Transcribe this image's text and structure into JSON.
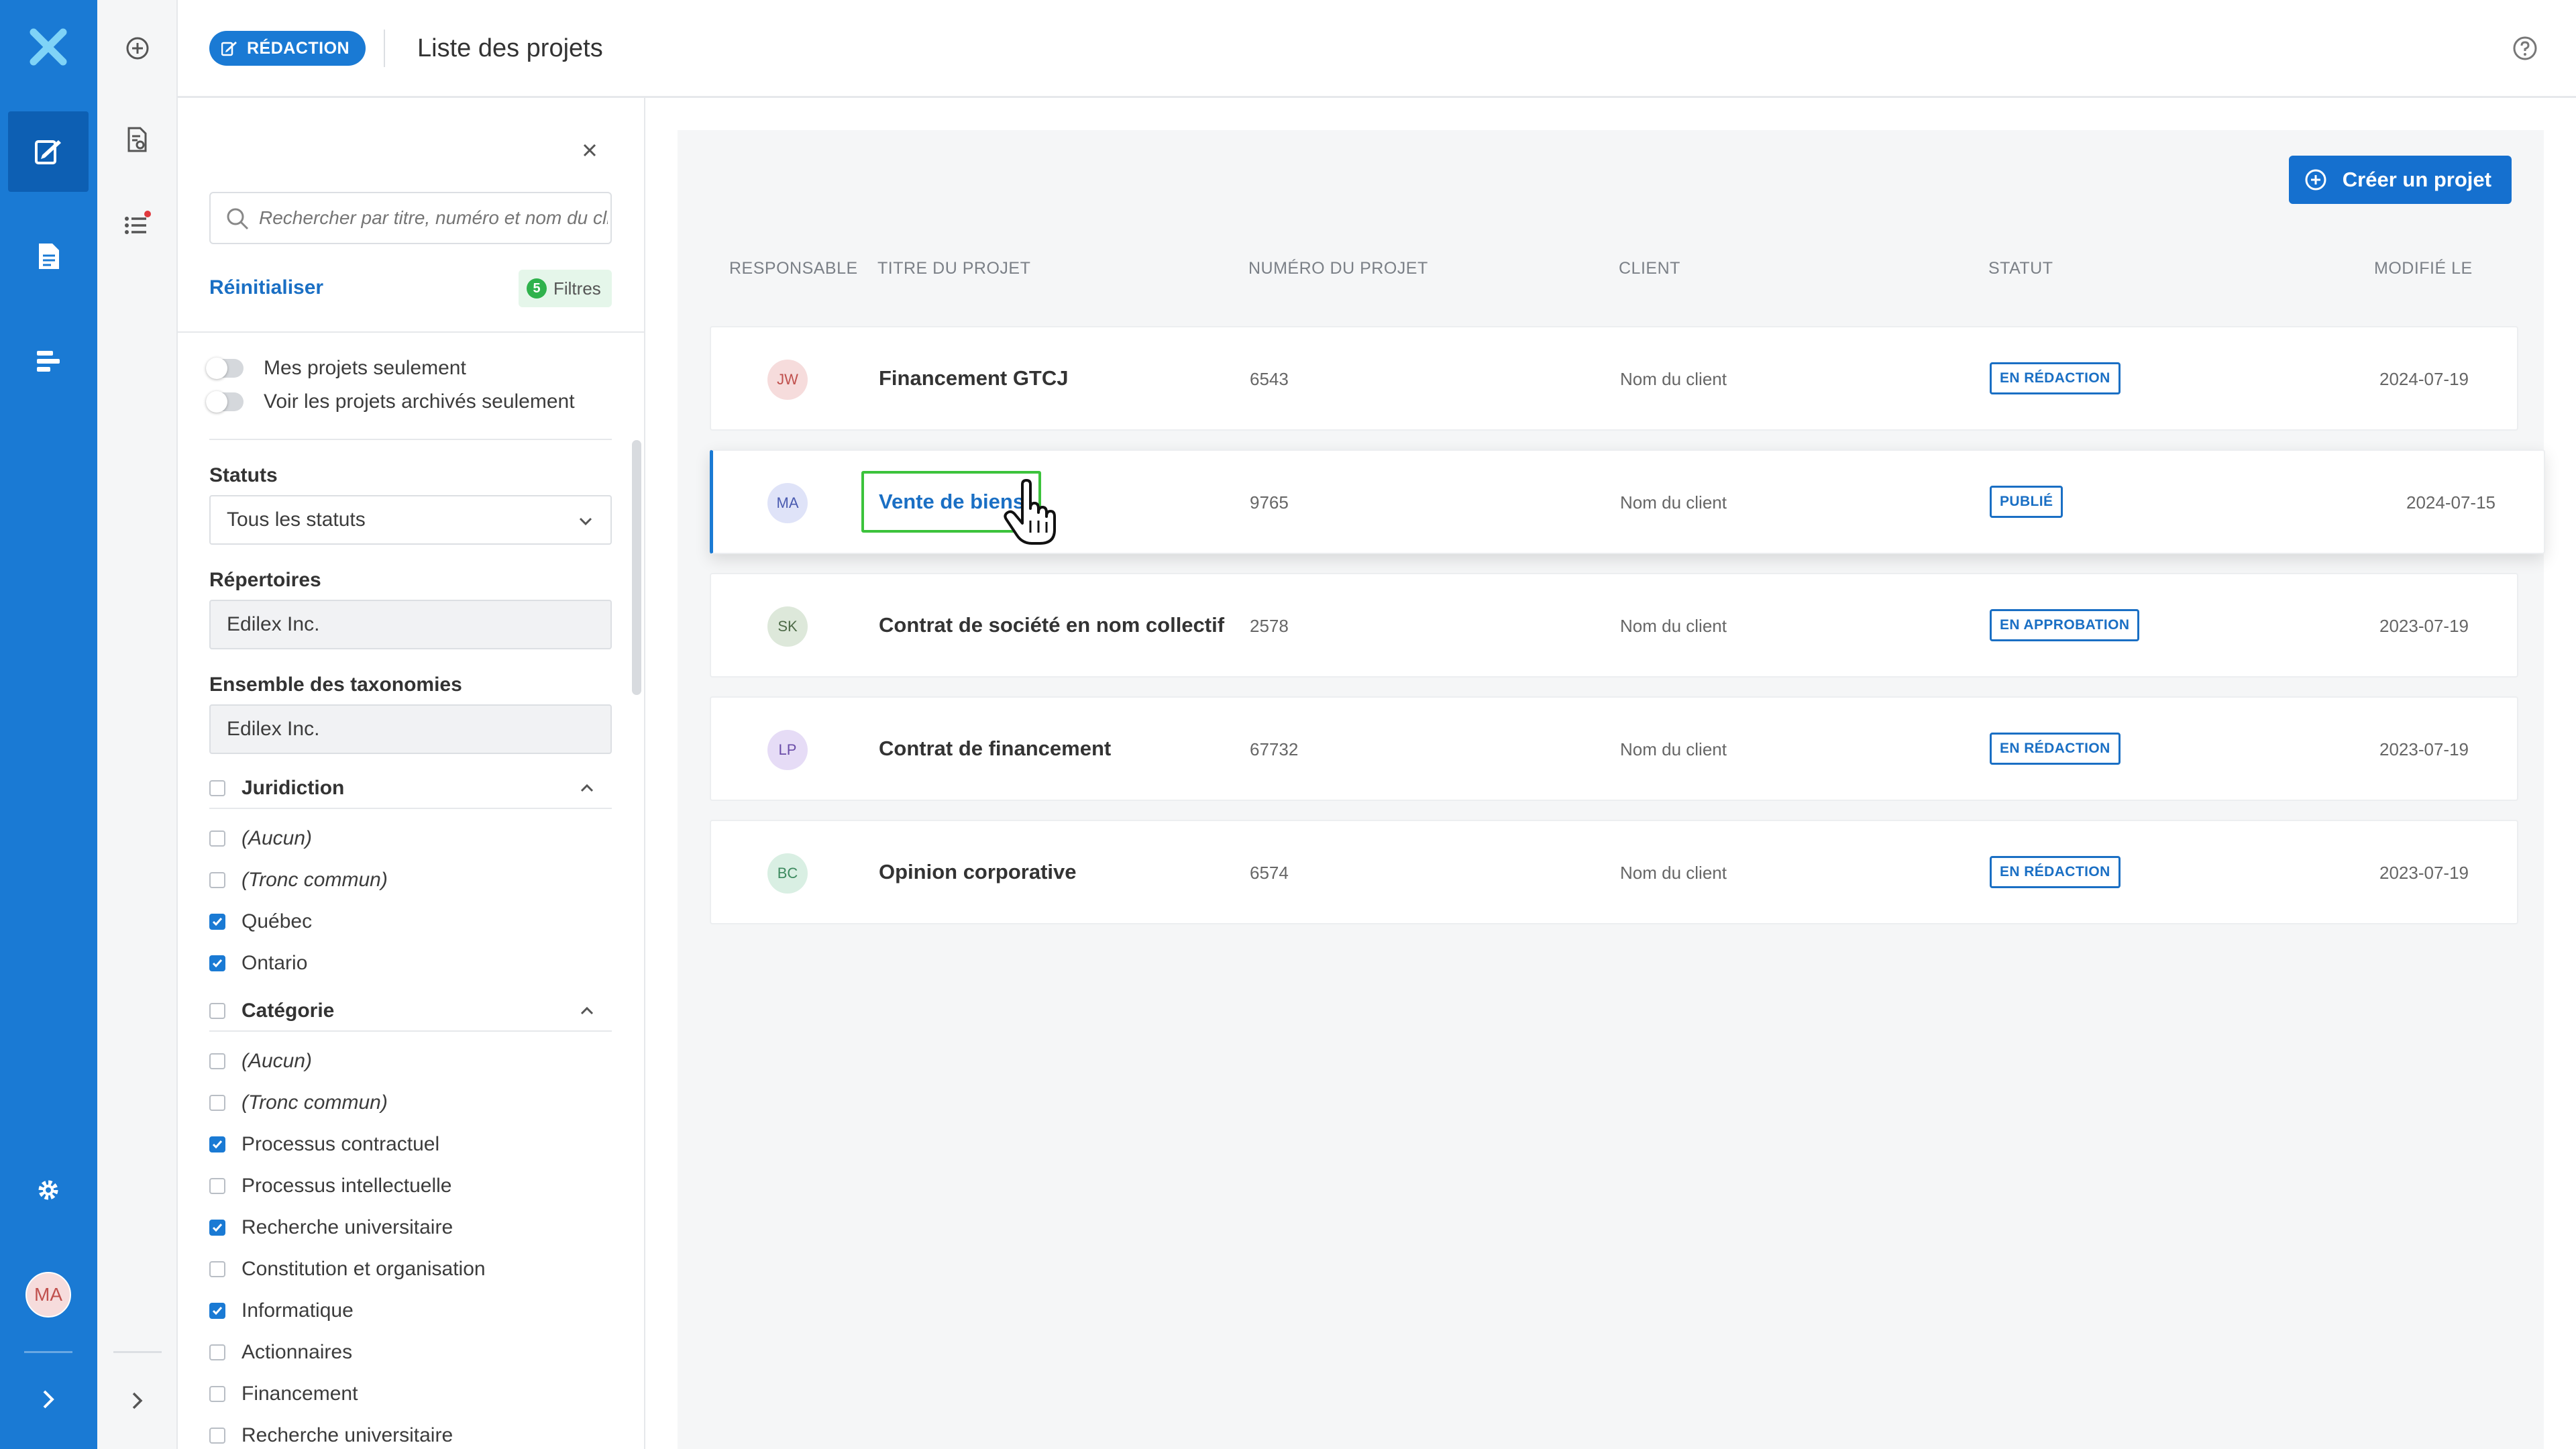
{
  "header": {
    "badge_label": "RÉDACTION",
    "title": "Liste des projets"
  },
  "rail": {
    "items": [
      "logo-icon",
      "drafting-icon",
      "document-icon",
      "list-icon",
      "settings-icon"
    ],
    "user_initials": "MA"
  },
  "filters": {
    "search_placeholder": "Rechercher par titre, numéro et nom du client",
    "reset_label": "Réinitialiser",
    "filters_count": "5",
    "filters_label": "Filtres",
    "toggle_my_projects": "Mes projets seulement",
    "toggle_archived": "Voir les projets archivés seulement",
    "status_label": "Statuts",
    "status_value": "Tous les statuts",
    "directories_label": "Répertoires",
    "directories_value": "Edilex Inc.",
    "taxonomies_label": "Ensemble des taxonomies",
    "taxonomies_value": "Edilex Inc.",
    "jurisdiction": {
      "label": "Juridiction",
      "options": [
        {
          "label": "(Aucun)",
          "checked": false,
          "italic": true
        },
        {
          "label": "(Tronc commun)",
          "checked": false,
          "italic": true
        },
        {
          "label": "Québec",
          "checked": true,
          "italic": false
        },
        {
          "label": "Ontario",
          "checked": true,
          "italic": false
        }
      ]
    },
    "category": {
      "label": "Catégorie",
      "options": [
        {
          "label": "(Aucun)",
          "checked": false,
          "italic": true
        },
        {
          "label": "(Tronc commun)",
          "checked": false,
          "italic": true
        },
        {
          "label": "Processus contractuel",
          "checked": true,
          "italic": false
        },
        {
          "label": "Processus intellectuelle",
          "checked": false,
          "italic": false
        },
        {
          "label": "Recherche universitaire",
          "checked": true,
          "italic": false
        },
        {
          "label": "Constitution et organisation",
          "checked": false,
          "italic": false
        },
        {
          "label": "Informatique",
          "checked": true,
          "italic": false
        },
        {
          "label": "Actionnaires",
          "checked": false,
          "italic": false
        },
        {
          "label": "Financement",
          "checked": false,
          "italic": false
        },
        {
          "label": "Recherche universitaire",
          "checked": false,
          "italic": false
        }
      ]
    }
  },
  "main": {
    "create_label": "Créer un projet",
    "columns": {
      "owner": "RESPONSABLE",
      "title": "TITRE DU PROJET",
      "number": "NUMÉRO DU PROJET",
      "client": "CLIENT",
      "status": "STATUT",
      "modified": "MODIFIÉ LE"
    },
    "rows": [
      {
        "initials": "JW",
        "avatar_bg": "#f6dcdc",
        "avatar_fg": "#c0504d",
        "title": "Financement GTCJ",
        "number": "6543",
        "client": "Nom du client",
        "status": "EN RÉDACTION",
        "date": "2024-07-19"
      },
      {
        "initials": "MA",
        "avatar_bg": "#dfe3f8",
        "avatar_fg": "#4a5bb0",
        "title": "Vente de biens",
        "number": "9765",
        "client": "Nom du client",
        "status": "PUBLIÉ",
        "date": "2024-07-15"
      },
      {
        "initials": "SK",
        "avatar_bg": "#dde8da",
        "avatar_fg": "#4d6a47",
        "title": "Contrat de société en nom collectif",
        "number": "2578",
        "client": "Nom du client",
        "status": "EN APPROBATION",
        "date": "2023-07-19"
      },
      {
        "initials": "LP",
        "avatar_bg": "#e6dcf6",
        "avatar_fg": "#6a4ca8",
        "title": "Contrat de financement",
        "number": "67732",
        "client": "Nom du client",
        "status": "EN RÉDACTION",
        "date": "2023-07-19"
      },
      {
        "initials": "BC",
        "avatar_bg": "#d9efe3",
        "avatar_fg": "#3d8a5f",
        "title": "Opinion corporative",
        "number": "6574",
        "client": "Nom du client",
        "status": "EN RÉDACTION",
        "date": "2023-07-19"
      }
    ],
    "selected_row": 1
  },
  "colors": {
    "primary": "#1a7ad4",
    "focus": "#3cc33c"
  }
}
